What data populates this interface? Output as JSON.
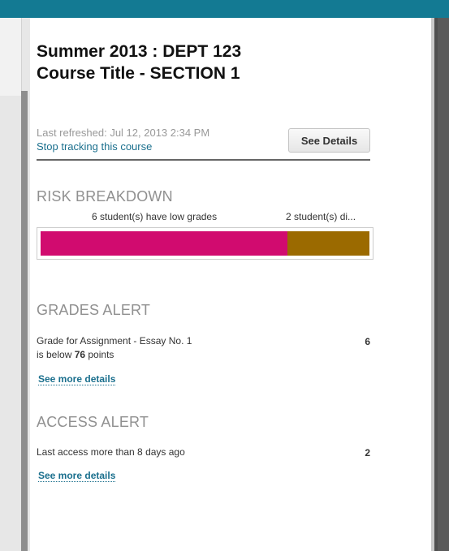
{
  "course": {
    "title_line1": "Summer 2013 : DEPT 123",
    "title_line2": "Course Title - SECTION 1"
  },
  "status": {
    "refreshed_text": "Last refreshed: Jul 12, 2013 2:34 PM",
    "stop_tracking_label": "Stop tracking this course",
    "see_details_label": "See Details"
  },
  "risk": {
    "heading": "RISK BREAKDOWN",
    "segments": [
      {
        "label": "6 student(s) have low grades",
        "students": 6,
        "color": "#d10b6f"
      },
      {
        "label": "2 student(s) di...",
        "students": 2,
        "color": "#9b6a00"
      }
    ]
  },
  "grades_alert": {
    "heading": "GRADES ALERT",
    "desc_line1": "Grade for Assignment - Essay No. 1",
    "desc_prefix": "is below ",
    "threshold": "76",
    "desc_suffix": " points",
    "count": "6",
    "more_label": "See more details"
  },
  "access_alert": {
    "heading": "ACCESS ALERT",
    "desc": "Last access more than 8 days ago",
    "count": "2",
    "more_label": "See more details"
  },
  "colors": {
    "header_bar": "#137a93",
    "link": "#1a6f8d",
    "low_grades": "#d10b6f",
    "access": "#9b6a00"
  }
}
